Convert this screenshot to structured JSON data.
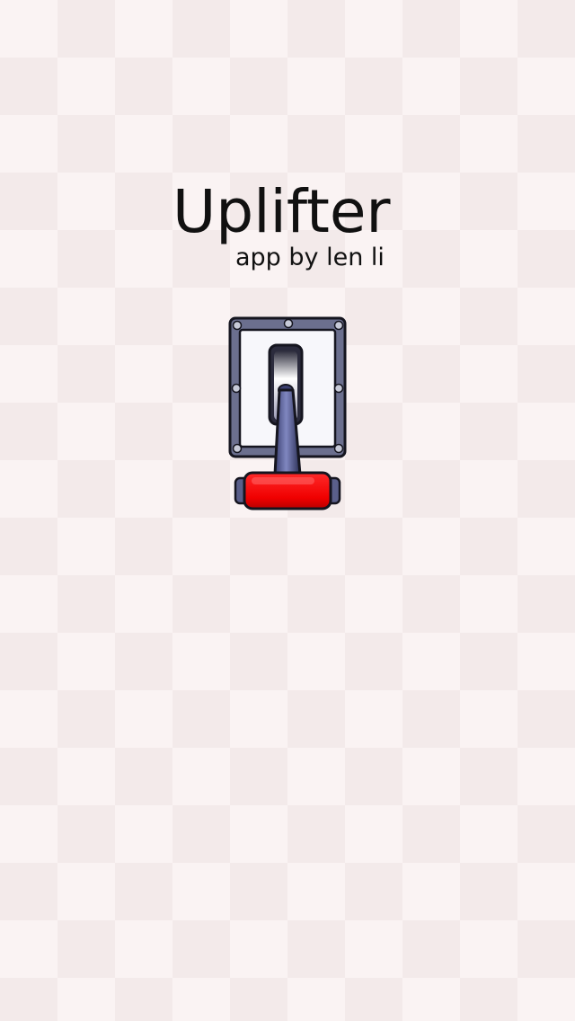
{
  "app": {
    "title": "Uplifter",
    "subtitle": "app by len li"
  },
  "lever": {
    "icon": "lever-switch-icon",
    "state": "down"
  },
  "colors": {
    "background_light": "#faf3f3",
    "background_dark": "#f3eaea",
    "plate": "#6b6f8e",
    "handle": "#ff1a1a"
  }
}
